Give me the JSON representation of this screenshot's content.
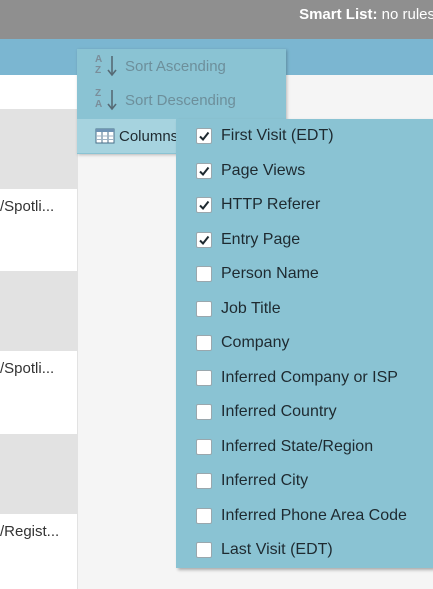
{
  "header": {
    "smart_list_label": "Smart List:",
    "smart_list_value": "no rules"
  },
  "left_rows": [
    {
      "text": "/Spotli..."
    },
    {
      "text": "/Spotli..."
    },
    {
      "text": "/Regist..."
    }
  ],
  "context_menu": {
    "items": [
      {
        "label": "Sort Ascending",
        "icon": "sort-ascending-icon",
        "enabled": false
      },
      {
        "label": "Sort Descending",
        "icon": "sort-descending-icon",
        "enabled": false
      },
      {
        "label": "Columns",
        "icon": "columns-icon",
        "enabled": true,
        "active": true
      }
    ]
  },
  "columns_submenu": {
    "items": [
      {
        "label": "First Visit (EDT)",
        "checked": true
      },
      {
        "label": "Page Views",
        "checked": true
      },
      {
        "label": "HTTP Referer",
        "checked": true
      },
      {
        "label": "Entry Page",
        "checked": true
      },
      {
        "label": "Person Name",
        "checked": false
      },
      {
        "label": "Job Title",
        "checked": false
      },
      {
        "label": "Company",
        "checked": false
      },
      {
        "label": "Inferred Company or ISP",
        "checked": false
      },
      {
        "label": "Inferred Country",
        "checked": false
      },
      {
        "label": "Inferred State/Region",
        "checked": false
      },
      {
        "label": "Inferred City",
        "checked": false
      },
      {
        "label": "Inferred Phone Area Code",
        "checked": false
      },
      {
        "label": "Last Visit (EDT)",
        "checked": false
      }
    ]
  },
  "colors": {
    "topbar": "#8f8f8f",
    "headerbar": "#7bb6d1",
    "menu_bg": "#8ac3d3",
    "menu_active": "#a6d3df"
  }
}
